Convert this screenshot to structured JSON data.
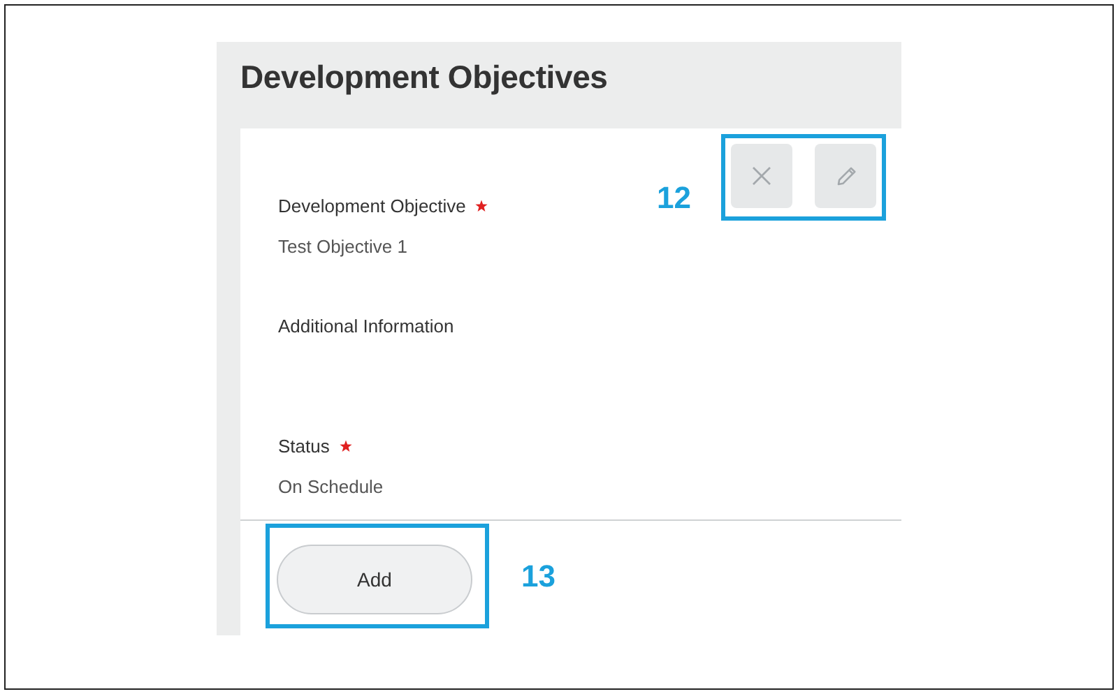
{
  "section": {
    "title": "Development Objectives"
  },
  "fields": [
    {
      "label": "Development Objective",
      "required": true,
      "value": "Test Objective 1"
    },
    {
      "label": "Additional Information",
      "required": false
    },
    {
      "label": "Status",
      "required": true,
      "value": "On Schedule"
    }
  ],
  "card_actions": [
    {
      "kind": "remove"
    },
    {
      "kind": "edit"
    }
  ],
  "add_button": {
    "label": "Add"
  },
  "callouts": [
    {
      "number": "12",
      "kind": "actions"
    },
    {
      "number": "13",
      "kind": "add"
    }
  ]
}
